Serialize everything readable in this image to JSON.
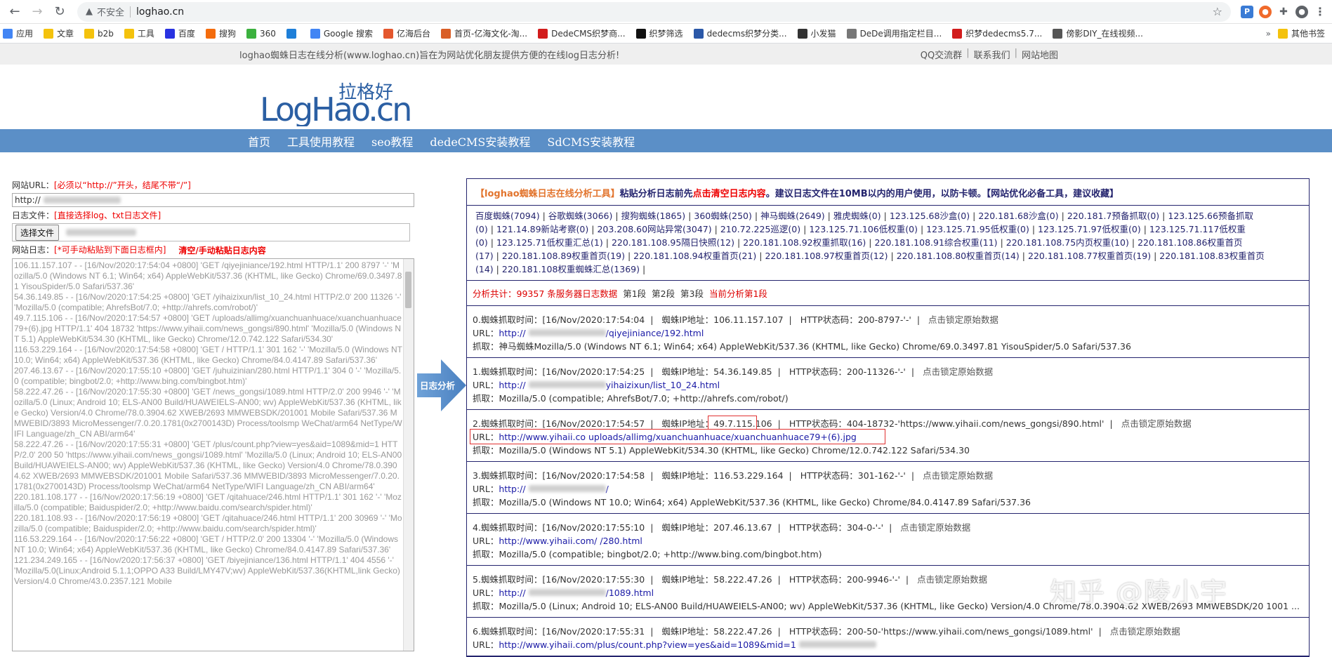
{
  "browser": {
    "insecure_label": "不安全",
    "url": "loghao.cn",
    "bookmarks": [
      {
        "label": "应用",
        "color": "#4285f4"
      },
      {
        "label": "文章",
        "color": "#f4c20d"
      },
      {
        "label": "b2b",
        "color": "#f4c20d"
      },
      {
        "label": "工具",
        "color": "#f4c20d"
      },
      {
        "label": "百度",
        "color": "#2932e1"
      },
      {
        "label": "搜狗",
        "color": "#f46c0d"
      },
      {
        "label": "360",
        "color": "#3cb13f"
      },
      {
        "label": "",
        "color": "#1e7fd8"
      },
      {
        "label": "Google 搜索",
        "color": "#4285f4"
      },
      {
        "label": "亿海后台",
        "color": "#e4572e"
      },
      {
        "label": "首页-亿海文化-淘...",
        "color": "#d95e26"
      },
      {
        "label": "DedeCMS织梦商...",
        "color": "#d21c1c"
      },
      {
        "label": "织梦筛选",
        "color": "#111111"
      },
      {
        "label": "dedecms织梦分类...",
        "color": "#2b58a8"
      },
      {
        "label": "小发猫",
        "color": "#333333"
      },
      {
        "label": "DeDe调用指定栏目...",
        "color": "#777777"
      },
      {
        "label": "织梦dedecms5.7...",
        "color": "#d21c1c"
      },
      {
        "label": "傍影DIY_在线视频...",
        "color": "#555555"
      }
    ],
    "bookmarks_more": "»",
    "other_bookmarks": "其他书签"
  },
  "site": {
    "slogan": "loghao蜘蛛日志在线分析(www.loghao.cn)旨在为网站优化朋友提供方便的在线log日志分析!",
    "top_links": [
      "QQ交流群",
      "联系我们",
      "网站地图"
    ],
    "logo_cn": "拉格好",
    "logo_en": "LogHao.cn",
    "nav": [
      "首页",
      "工具使用教程",
      "seo教程",
      "dedeCMS安装教程",
      "SdCMS安装教程"
    ]
  },
  "form": {
    "url_label": "网站URL：",
    "url_hint": "[必须以“http://”开头，结尾不带“/”]",
    "url_value": "http://",
    "file_label": "日志文件：",
    "file_hint": "[直接选择log、txt日志文件]",
    "file_button": "选择文件",
    "log_label": "网站日志：",
    "log_hint": "[*可手动粘贴到下面日志框内]",
    "clear_link": "清空/手动粘贴日志内容",
    "log_text": "106.11.157.107 - - [16/Nov/2020:17:54:04 +0800] 'GET /qiyejiniance/192.html HTTP/1.1' 200 8797 '-' 'Mozilla/5.0 (Windows NT 6.1; Win64; x64) AppleWebKit/537.36 (KHTML, like Gecko) Chrome/69.0.3497.81 YisouSpider/5.0 Safari/537.36'\n54.36.149.85 - - [16/Nov/2020:17:54:25 +0800] 'GET /yihaizixun/list_10_24.html HTTP/2.0' 200 11326 '-' 'Mozilla/5.0 (compatible; AhrefsBot/7.0; +http://ahrefs.com/robot/)'\n49.7.115.106 - - [16/Nov/2020:17:54:57 +0800] 'GET /uploads/allimg/xuanchuanhuace/xuanchuanhuace79+(6).jpg HTTP/1.1' 404 18732 'https://www.yihaii.com/news_gongsi/890.html' 'Mozilla/5.0 (Windows NT 5.1) AppleWebKit/534.30 (KHTML, like Gecko) Chrome/12.0.742.122 Safari/534.30'\n116.53.229.164 - - [16/Nov/2020:17:54:58 +0800] 'GET / HTTP/1.1' 301 162 '-' 'Mozilla/5.0 (Windows NT 10.0; Win64; x64) AppleWebKit/537.36 (KHTML, like Gecko) Chrome/84.0.4147.89 Safari/537.36'\n207.46.13.67 - - [16/Nov/2020:17:55:10 +0800] 'GET /juhuizinian/280.html HTTP/1.1' 304 0 '-' 'Mozilla/5.0 (compatible; bingbot/2.0; +http://www.bing.com/bingbot.htm)'\n58.222.47.26 - - [16/Nov/2020:17:55:30 +0800] 'GET /news_gongsi/1089.html HTTP/2.0' 200 9946 '-' 'Mozilla/5.0 (Linux; Android 10; ELS-AN00 Build/HUAWEIELS-AN00; wv) AppleWebKit/537.36 (KHTML, like Gecko) Version/4.0 Chrome/78.0.3904.62 XWEB/2693 MMWEBSDK/201001 Mobile Safari/537.36 MMWEBID/3893 MicroMessenger/7.0.20.1781(0x2700143D) Process/toolsmp WeChat/arm64 NetType/WIFI Language/zh_CN ABI/arm64'\n58.222.47.26 - - [16/Nov/2020:17:55:31 +0800] 'GET /plus/count.php?view=yes&aid=1089&mid=1 HTTP/2.0' 200 50 'https://www.yihaii.com/news_gongsi/1089.html' 'Mozilla/5.0 (Linux; Android 10; ELS-AN00 Build/HUAWEIELS-AN00; wv) AppleWebKit/537.36 (KHTML, like Gecko) Version/4.0 Chrome/78.0.3904.62 XWEB/2693 MMWEBSDK/201001 Mobile Safari/537.36 MMWEBID/3893 MicroMessenger/7.0.20.1781(0x2700143D) Process/toolsmp WeChat/arm64 NetType/WIFI Language/zh_CN ABI/arm64'\n220.181.108.177 - - [16/Nov/2020:17:56:19 +0800] 'GET /qitahuace/246.html HTTP/1.1' 301 162 '-' 'Mozilla/5.0 (compatible; Baiduspider/2.0; +http://www.baidu.com/search/spider.html)'\n220.181.108.93 - - [16/Nov/2020:17:56:19 +0800] 'GET /qitahuace/246.html HTTP/1.1' 200 30969 '-' 'Mozilla/5.0 (compatible; Baiduspider/2.0; +http://www.baidu.com/search/spider.html)'\n116.53.229.164 - - [16/Nov/2020:17:56:22 +0800] 'GET / HTTP/2.0' 200 13304 '-' 'Mozilla/5.0 (Windows NT 10.0; Win64; x64) AppleWebKit/537.36 (KHTML, like Gecko) Chrome/84.0.4147.89 Safari/537.36'\n121.234.249.165 - - [16/Nov/2020:17:56:37 +0800] 'GET /biyejiniance/136.html HTTP/1.1' 404 4556 '-' 'Mozilla/5.0(Linux;Android 5.1.1;OPPO A33 Build/LMY47V;wv) AppleWebKit/537.36(KHTML,link Gecko) Version/4.0 Chrome/43.0.2357.121 Mobile"
  },
  "arrow_label": "日志分析",
  "result": {
    "header_title": "【loghao蜘蛛日志在线分析工具】",
    "header_t1": "粘贴分析日志前先",
    "header_clear": "点击清空日志内容",
    "header_t2": "。建议日志文件在10MB以内的用户使用，以防卡顿。",
    "header_t3": "【网站优化必备工具，建议收藏】",
    "spider_links": [
      "百度蜘蛛(7094)",
      "谷歌蜘蛛(3066)",
      "搜狗蜘蛛(1865)",
      "360蜘蛛(250)",
      "神马蜘蛛(2649)",
      "雅虎蜘蛛(0)",
      "123.125.68沙盒(0)",
      "220.181.68沙盒(0)",
      "220.181.7预备抓取(0)",
      "123.125.66预备抓取(0)",
      "121.14.89新站考察(0)",
      "203.208.60网站异常(3047)",
      "210.72.225巡逻(0)",
      "123.125.71.106低权重(0)",
      "123.125.71.95低权重(0)",
      "123.125.71.97低权重(0)",
      "123.125.71.117低权重(0)",
      "123.125.71低权重汇总(1)",
      "220.181.108.95隔日快照(12)",
      "220.181.108.92权重抓取(16)",
      "220.181.108.91综合权重(11)",
      "220.181.108.75内页权重(10)",
      "220.181.108.86权重首页(17)",
      "220.181.108.89权重首页(19)",
      "220.181.108.94权重首页(21)",
      "220.181.108.97权重首页(12)",
      "220.181.108.80权重首页(14)",
      "220.181.108.77权重首页(19)",
      "220.181.108.83权重首页(14)",
      "220.181.108权重蜘蛛汇总(1369)"
    ],
    "stats_prefix": "分析共计：",
    "stats_count": "99357",
    "stats_suffix": "条服务器日志数据",
    "segments": [
      "第1段",
      "第2段",
      "第3段"
    ],
    "current_segment": "当前分析第1段",
    "records": [
      {
        "time": "0.蜘蛛抓取时间：[16/Nov/2020:17:54:04",
        "ip": "蜘蛛IP地址：106.11.157.107",
        "status": "HTTP状态码：200-8797-'-'",
        "lock": "点击锁定原始数据",
        "url_prefix": "URL：",
        "url": "http://",
        "url_tail": "/qiyejiniance/192.html",
        "crawl": "抓取：神马蜘蛛Mozilla/5.0 (Windows NT 6.1; Win64; x64) AppleWebKit/537.36 (KHTML, like Gecko) Chrome/69.0.3497.81 YisouSpider/5.0 Safari/537.36"
      },
      {
        "time": "1.蜘蛛抓取时间：[16/Nov/2020:17:54:25",
        "ip": "蜘蛛IP地址：54.36.149.85",
        "status": "HTTP状态码：200-11326-'-'",
        "lock": "点击锁定原始数据",
        "url_prefix": "URL：",
        "url": "http://",
        "url_tail": "yihaizixun/list_10_24.html",
        "crawl": "抓取：Mozilla/5.0 (compatible; AhrefsBot/7.0; +http://ahrefs.com/robot/)"
      },
      {
        "time": "2.蜘蛛抓取时间：[16/Nov/2020:17:54:57",
        "ip_label": "蜘蛛IP地址：",
        "ip_value": "49.7.115.106",
        "status": "HTTP状态码：404-18732-'https://www.yihaii.com/news_gongsi/890.html'",
        "lock": "点击锁定原始数据",
        "url_prefix": "URL：",
        "url": "http://www.yihaii.co",
        "url_tail": "uploads/allimg/xuanchuanhuace/xuanchuanhuace79+(6).jpg",
        "crawl": "抓取：Mozilla/5.0 (Windows NT 5.1) AppleWebKit/534.30 (KHTML, like Gecko) Chrome/12.0.742.122 Safari/534.30"
      },
      {
        "time": "3.蜘蛛抓取时间：[16/Nov/2020:17:54:58",
        "ip": "蜘蛛IP地址：116.53.229.164",
        "status": "HTTP状态码：301-162-'-'",
        "lock": "点击锁定原始数据",
        "url_prefix": "URL：",
        "url": "http://",
        "url_tail": "/",
        "crawl": "抓取：Mozilla/5.0 (Windows NT 10.0; Win64; x64) AppleWebKit/537.36 (KHTML, like Gecko) Chrome/84.0.4147.89 Safari/537.36"
      },
      {
        "time": "4.蜘蛛抓取时间：[16/Nov/2020:17:55:10",
        "ip": "蜘蛛IP地址：207.46.13.67",
        "status": "HTTP状态码：304-0-'-'",
        "lock": "点击锁定原始数据",
        "url_prefix": "URL：",
        "url": "http://www.yihaii.com/",
        "url_tail": "/280.html",
        "crawl": "抓取：Mozilla/5.0 (compatible; bingbot/2.0; +http://www.bing.com/bingbot.htm)"
      },
      {
        "time": "5.蜘蛛抓取时间：[16/Nov/2020:17:55:30",
        "ip": "蜘蛛IP地址：58.222.47.26",
        "status": "HTTP状态码：200-9946-'-'",
        "lock": "点击锁定原始数据",
        "url_prefix": "URL：",
        "url": "http://",
        "url_tail": "/1089.html",
        "crawl": "抓取：Mozilla/5.0 (Linux; Android 10; ELS-AN00 Build/HUAWEIELS-AN00; wv) AppleWebKit/537.36 (KHTML, like Gecko) Version/4.0 Chrome/78.0.3904.62 XWEB/2693 MMWEBSDK/20 1001 ..."
      },
      {
        "time": "6.蜘蛛抓取时间：[16/Nov/2020:17:55:31",
        "ip": "蜘蛛IP地址：58.222.47.26",
        "status": "HTTP状态码：200-50-'https://www.yihaii.com/news_gongsi/1089.html'",
        "lock": "点击锁定原始数据",
        "url_prefix": "URL：",
        "url": "http://www.yihaii.com/plus/count.php?view=yes&aid=1089&mid=1",
        "url_tail": "",
        "crawl": ""
      }
    ]
  },
  "watermark": "知乎 @陵小宇"
}
